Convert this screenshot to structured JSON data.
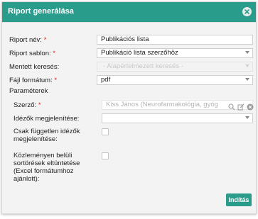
{
  "dialog": {
    "title": "Riport generálása"
  },
  "form": {
    "report_name": {
      "label": "Riport név:",
      "required": "*",
      "value": "Publikációs lista"
    },
    "report_template": {
      "label": "Riport sablon:",
      "required": "*",
      "value": "Publikáció lista szerzőhöz"
    },
    "saved_search": {
      "label": "Mentett keresés:",
      "placeholder": "- Alapértelmezett keresés -"
    },
    "file_format": {
      "label": "Fájl formátum:",
      "required": "*",
      "value": "pdf"
    },
    "parameters_heading": "Paraméterek",
    "author": {
      "label": "Szerző:",
      "required": "*",
      "placeholder": "Kiss János (Neurofarmakológia, gyóg"
    },
    "citations_display": {
      "label": "Idézők megjelenítése:",
      "value": ""
    },
    "independent_citations": {
      "label": "Csak független idézők megjelenítése:"
    },
    "bulletin_breaks": {
      "label": "Közleményen belüli sortörések eltüntetése (Excel formátumhoz ajánlott):"
    }
  },
  "buttons": {
    "start": "Indítás"
  },
  "colors": {
    "accent": "#2a9c8c",
    "required": "#e02020"
  }
}
